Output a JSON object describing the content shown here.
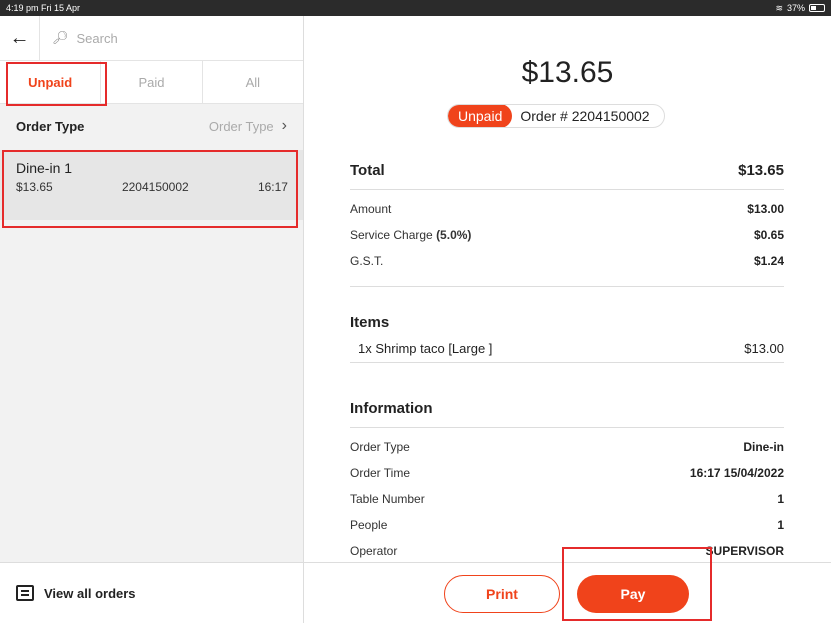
{
  "status_bar": {
    "time": "4:19 pm  Fri 15 Apr",
    "battery": "37%"
  },
  "search": {
    "placeholder": "Search"
  },
  "tabs": [
    {
      "label": "Unpaid"
    },
    {
      "label": "Paid"
    },
    {
      "label": "All"
    }
  ],
  "order_type_filter": {
    "label": "Order Type",
    "value": "Order Type"
  },
  "order_card": {
    "title": "Dine-in  1",
    "amount": "$13.65",
    "number": "2204150002",
    "time": "16:17"
  },
  "left_footer": {
    "label": "View all orders"
  },
  "detail": {
    "total_big": "$13.65",
    "status": "Unpaid",
    "order_label": "Order # 2204150002",
    "total": {
      "label": "Total",
      "value": "$13.65"
    },
    "amount": {
      "label": "Amount",
      "value": "$13.00"
    },
    "service": {
      "label": "Service Charge",
      "pct": "(5.0%)",
      "value": "$0.65"
    },
    "gst": {
      "label": "G.S.T.",
      "value": "$1.24"
    },
    "items_title": "Items",
    "items": [
      {
        "name": "1x Shrimp taco  [Large ]",
        "price": "$13.00"
      }
    ],
    "info_title": "Information",
    "info": [
      {
        "label": "Order Type",
        "value": "Dine-in"
      },
      {
        "label": "Order Time",
        "value": "16:17  15/04/2022"
      },
      {
        "label": "Table Number",
        "value": "1"
      },
      {
        "label": "People",
        "value": "1"
      },
      {
        "label": "Operator",
        "value": "SUPERVISOR"
      }
    ]
  },
  "actions": {
    "print": "Print",
    "pay": "Pay"
  },
  "colors": {
    "accent": "#f0431b",
    "highlight": "#e52b2b"
  }
}
